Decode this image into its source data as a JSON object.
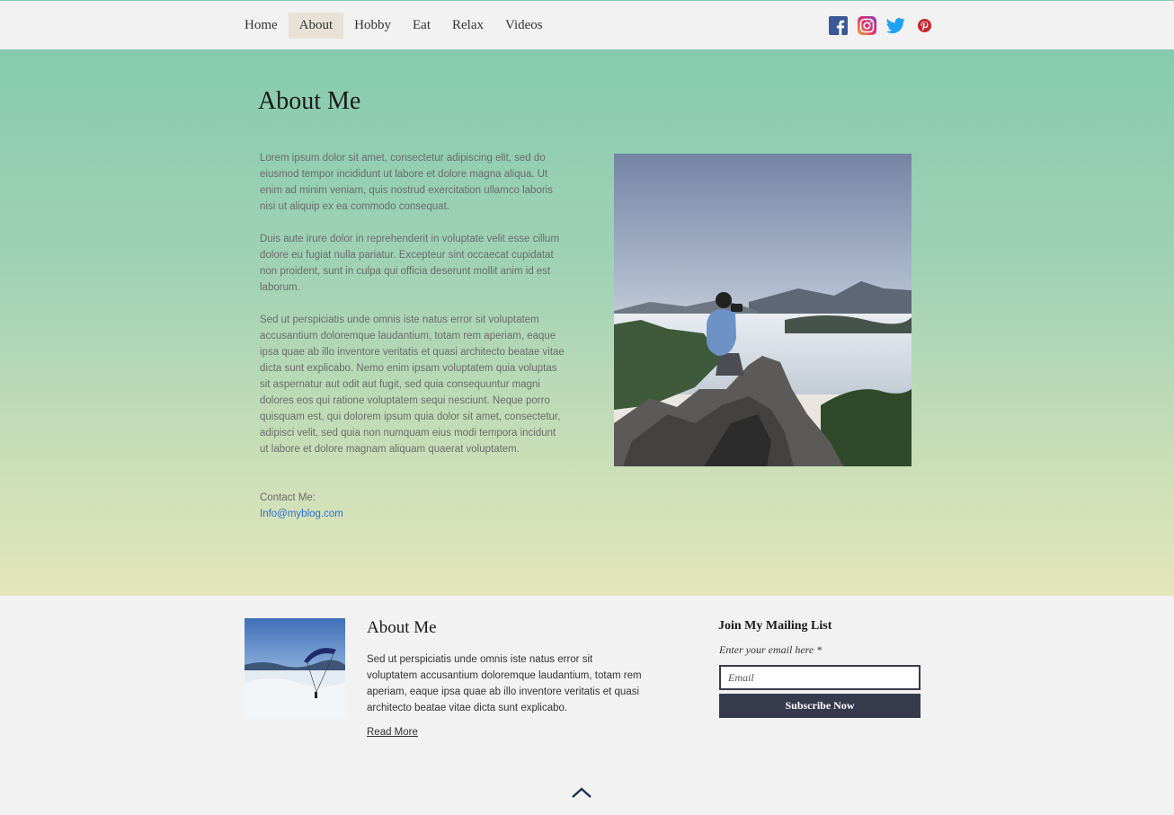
{
  "nav": {
    "items": [
      {
        "label": "Home"
      },
      {
        "label": "About",
        "active": true
      },
      {
        "label": "Hobby"
      },
      {
        "label": "Eat"
      },
      {
        "label": "Relax"
      },
      {
        "label": "Videos"
      }
    ]
  },
  "social": {
    "icons": [
      "facebook-icon",
      "instagram-icon",
      "twitter-icon",
      "pinterest-icon"
    ]
  },
  "hero": {
    "title": "About Me",
    "paragraphs": [
      "Lorem ipsum dolor sit amet, consectetur adipiscing elit, sed do eiusmod tempor incididunt ut labore et dolore magna aliqua. Ut enim ad minim veniam, quis nostrud exercitation ullamco laboris nisi ut aliquip ex ea commodo consequat.",
      "Duis aute irure dolor in reprehenderit in voluptate velit esse cillum dolore eu fugiat nulla pariatur. Excepteur sint occaecat cupidatat non proident, sunt in culpa qui officia deserunt mollit anim id est laborum.",
      "Sed ut perspiciatis unde omnis iste natus error sit voluptatem accusantium doloremque laudantium, totam rem aperiam, eaque ipsa quae ab illo inventore veritatis et quasi architecto beatae vitae dicta sunt explicabo. Nemo enim ipsam voluptatem quia voluptas sit aspernatur aut odit aut fugit, sed quia consequuntur magni dolores eos qui ratione voluptatem sequi nesciunt. Neque porro quisquam est, qui dolorem ipsum quia dolor sit amet, consectetur, adipisci velit, sed quia non numquam eius modi tempora incidunt ut labore et dolore magnam aliquam quaerat voluptatem."
    ],
    "contact_label": "Contact Me:",
    "contact_email": "Info@myblog.com"
  },
  "footer": {
    "about_title": "About Me",
    "about_text": "Sed ut perspiciatis unde omnis iste natus error sit voluptatem accusantium doloremque laudantium, totam rem aperiam, eaque ipsa quae ab illo inventore veritatis et quasi architecto beatae vitae dicta sunt explicabo.",
    "read_more": "Read More",
    "mailing": {
      "title": "Join My Mailing List",
      "label": "Enter your email here *",
      "placeholder": "Email",
      "button": "Subscribe Now"
    }
  },
  "colors": {
    "accent_green": "#86cbb0",
    "link_blue": "#2a6ed6",
    "button_navy": "#363a4d"
  }
}
